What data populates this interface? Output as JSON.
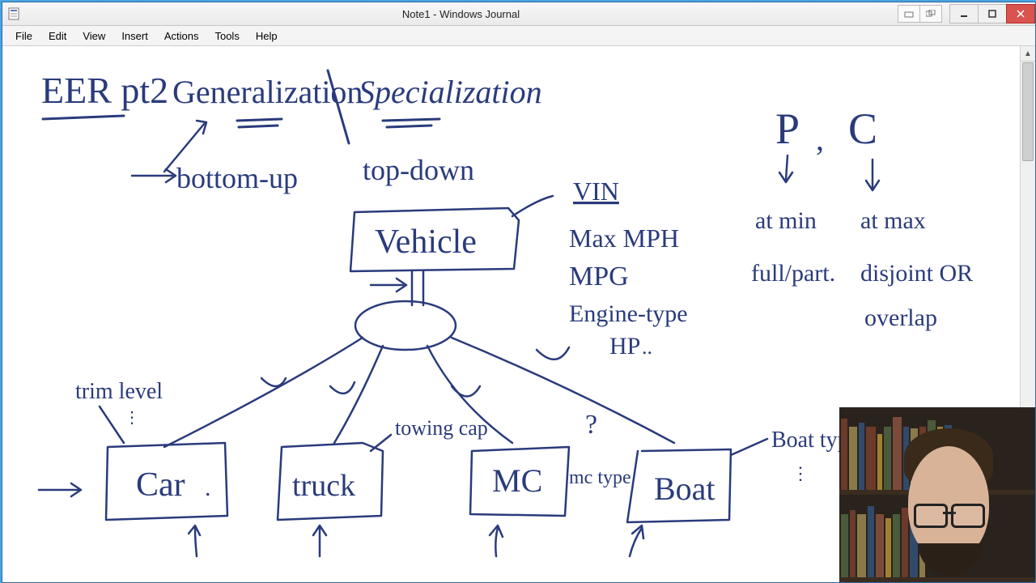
{
  "window": {
    "title": "Note1 - Windows Journal",
    "menus": [
      "File",
      "Edit",
      "View",
      "Insert",
      "Actions",
      "Tools",
      "Help"
    ]
  },
  "ink": {
    "color": "#2a3b7c",
    "title_line1": "EER pt2",
    "title_line2": "Generalization",
    "title_line3": "Specialization",
    "bottom_up": "bottom-up",
    "top_down": "top-down",
    "vehicle": "Vehicle",
    "vin": "VIN",
    "maxmph": "Max MPH",
    "mpg": "MPG",
    "engine_type": "Engine-type",
    "hp": "HP",
    "trim_level": "trim level",
    "car": "Car",
    "truck": "truck",
    "mc": "MC",
    "boat": "Boat",
    "towing_cap": "towing cap",
    "mctype": "mc type",
    "boat_type": "Boat type",
    "question": "?",
    "p": "P",
    "c": "C",
    "comma": ",",
    "at_min": "at min",
    "full_part": "full/part.",
    "at_max": "at max",
    "disjoint_or": "disjoint OR",
    "overlap": "overlap",
    "ellipsis1": "⋮",
    "ellipsis2": "⋮"
  },
  "chart_data": {
    "type": "diagram",
    "description": "EER generalization/specialization hierarchy",
    "superclass": {
      "name": "Vehicle",
      "attributes": [
        "VIN",
        "Max MPH",
        "MPG",
        "Engine-type",
        "HP"
      ]
    },
    "subclasses": [
      {
        "name": "Car",
        "local_attributes": [
          "trim level"
        ]
      },
      {
        "name": "truck",
        "local_attributes": [
          "towing cap"
        ]
      },
      {
        "name": "MC",
        "local_attributes": [
          "mc type",
          "?"
        ]
      },
      {
        "name": "Boat",
        "local_attributes": [
          "Boat type"
        ]
      }
    ],
    "approaches": {
      "Generalization": "bottom-up",
      "Specialization": "top-down"
    },
    "constraints_legend": {
      "P": [
        "at min",
        "full/part."
      ],
      "C": [
        "at max",
        "disjoint OR",
        "overlap"
      ]
    }
  }
}
